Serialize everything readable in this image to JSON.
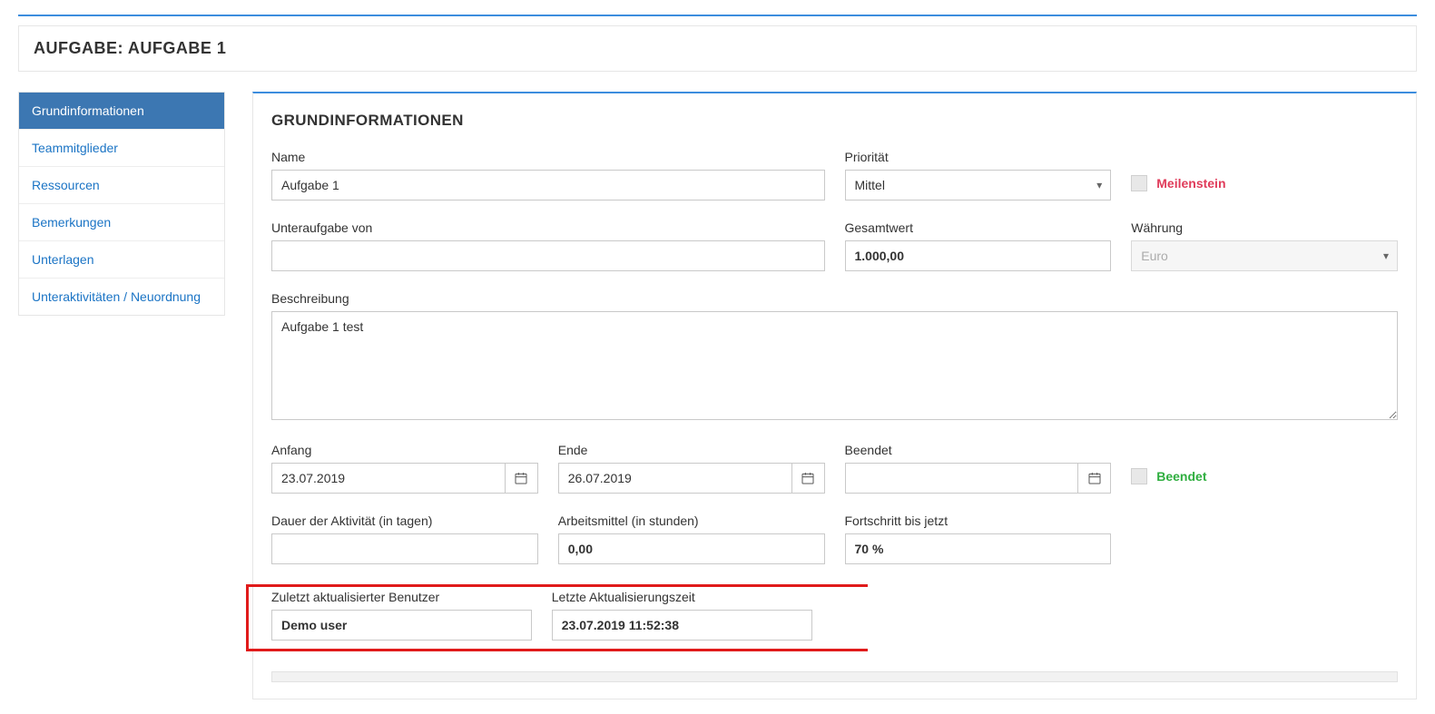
{
  "header": {
    "title": "AUFGABE: AUFGABE 1"
  },
  "sidebar": {
    "items": [
      {
        "label": "Grundinformationen",
        "active": true
      },
      {
        "label": "Teammitglieder",
        "active": false
      },
      {
        "label": "Ressourcen",
        "active": false
      },
      {
        "label": "Bemerkungen",
        "active": false
      },
      {
        "label": "Unterlagen",
        "active": false
      },
      {
        "label": "Unteraktivitäten / Neuordnung",
        "active": false
      }
    ]
  },
  "main": {
    "section_title": "GRUNDINFORMATIONEN",
    "fields": {
      "name": {
        "label": "Name",
        "value": "Aufgabe 1"
      },
      "priority": {
        "label": "Priorität",
        "value": "Mittel"
      },
      "milestone": {
        "label": "Meilenstein"
      },
      "subtask_of": {
        "label": "Unteraufgabe von",
        "value": ""
      },
      "total_value": {
        "label": "Gesamtwert",
        "value": "1.000,00"
      },
      "currency": {
        "label": "Währung",
        "value": "Euro"
      },
      "description": {
        "label": "Beschreibung",
        "value": "Aufgabe 1 test"
      },
      "start": {
        "label": "Anfang",
        "value": "23.07.2019"
      },
      "end": {
        "label": "Ende",
        "value": "26.07.2019"
      },
      "finished_date": {
        "label": "Beendet",
        "value": ""
      },
      "finished_chk": {
        "label": "Beendet"
      },
      "duration": {
        "label": "Dauer der Aktivität (in tagen)",
        "value": ""
      },
      "work_hours": {
        "label": "Arbeitsmittel (in stunden)",
        "value": "0,00"
      },
      "progress": {
        "label": "Fortschritt bis jetzt",
        "value": "70 %"
      },
      "last_user": {
        "label": "Zuletzt aktualisierter Benutzer",
        "value": "Demo user"
      },
      "last_time": {
        "label": "Letzte Aktualisierungszeit",
        "value": "23.07.2019 11:52:38"
      }
    }
  }
}
